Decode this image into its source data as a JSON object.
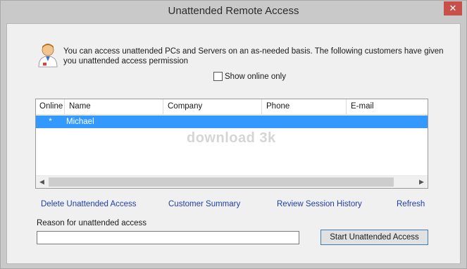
{
  "window": {
    "title": "Unattended Remote Access",
    "close_glyph": "✕"
  },
  "info": {
    "text": "You can access unattended PCs and Servers on an as-needed basis.  The following customers have given you unattended access permission",
    "icon": "user-avatar-icon"
  },
  "show_online": {
    "label": "Show online only",
    "checked": false
  },
  "table": {
    "columns": [
      "Online",
      "Name",
      "Company",
      "Phone",
      "E-mail"
    ],
    "rows": [
      {
        "online": "*",
        "name": "Michael",
        "company": "",
        "phone": "",
        "email": "",
        "selected": true
      }
    ]
  },
  "watermark": "download 3k",
  "links": {
    "delete": "Delete Unattended Access",
    "summary": "Customer Summary",
    "history": "Review Session History",
    "refresh": "Refresh"
  },
  "reason": {
    "label": "Reason for unattended access",
    "value": ""
  },
  "start_button": "Start Unattended Access",
  "scroll": {
    "left_glyph": "◀",
    "right_glyph": "▶"
  }
}
